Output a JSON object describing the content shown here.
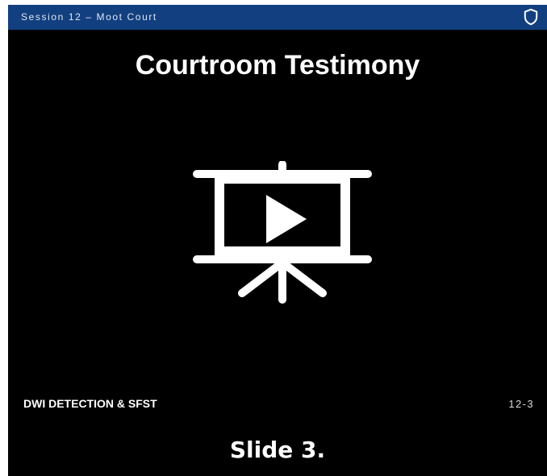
{
  "slide": {
    "session_label": "Session 12 – Moot Court",
    "title": "Courtroom Testimony",
    "footer_left": "DWI DETECTION & SFST",
    "footer_right": "12-3",
    "caption": "Slide 3.",
    "icons": [
      "shield-icon",
      "video-presentation-icon"
    ]
  },
  "colors": {
    "header_bar": "#123f7f",
    "slide_background": "#000000",
    "text": "#ffffff"
  }
}
